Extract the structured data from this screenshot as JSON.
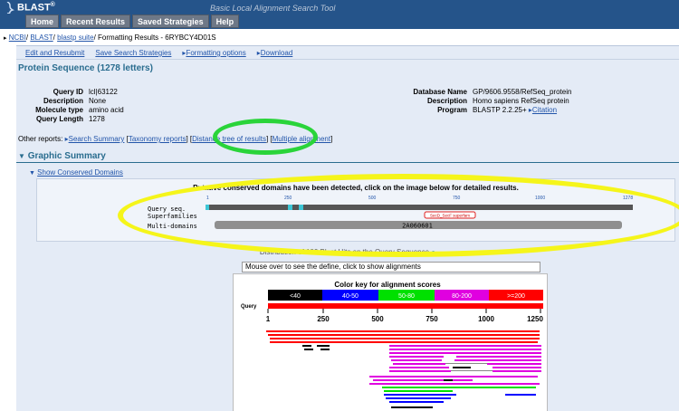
{
  "header": {
    "brand": "BLAST",
    "reg": "®",
    "app_title": "Basic Local Alignment Search Tool",
    "nav": [
      "Home",
      "Recent Results",
      "Saved Strategies",
      "Help"
    ]
  },
  "breadcrumb": {
    "ncbi": "NCBI",
    "blast": "BLAST",
    "suite": "blastp suite",
    "current": "Formatting Results - 6RYBCY4D01S"
  },
  "toolbar": {
    "edit": "Edit and Resubmit",
    "save": "Save Search Strategies",
    "formatting": "Formatting options",
    "download": "Download"
  },
  "title": "Protein Sequence (1278 letters)",
  "query_info": {
    "labels": [
      "Query ID",
      "Description",
      "Molecule type",
      "Query Length"
    ],
    "values": [
      "lcl|63122",
      "None",
      "amino acid",
      "1278"
    ]
  },
  "db_info": {
    "labels": [
      "Database Name",
      "Description",
      "Program"
    ],
    "values": [
      "GP/9606.9558/RefSeq_protein",
      "Homo sapiens RefSeq protein",
      "BLASTP 2.2.25+"
    ],
    "citation": "Citation"
  },
  "other_reports": {
    "label": "Other reports:",
    "search_summary": "Search Summary",
    "taxonomy": "Taxonomy reports",
    "distance_tree": "Distance tree of results",
    "multiple": "Multiple alignment"
  },
  "graphic_summary": {
    "title": "Graphic Summary",
    "show_cd": "Show Conserved Domains",
    "cd_note": "Putative conserved domains have been detected, click on the image below for detailed results.",
    "rows": [
      "Query seq.",
      "Superfamilies",
      "Multi-domains"
    ],
    "ticks": [
      "1",
      "250",
      "500",
      "750",
      "1000",
      "1278"
    ],
    "superfamily_label": "SecD_SecF superfam",
    "multidomain_label": "2A060601"
  },
  "distribution": {
    "title": "Distribution of 100 Blast Hits on the Query Sequence",
    "mouseover": "Mouse over to see the define, click to show alignments",
    "color_key_title": "Color key for alignment scores",
    "color_key": [
      {
        "label": "<40",
        "color": "#000000"
      },
      {
        "label": "40-50",
        "color": "#0000ff"
      },
      {
        "label": "50-80",
        "color": "#00e000"
      },
      {
        "label": "80-200",
        "color": "#e000e0"
      },
      {
        "label": ">=200",
        "color": "#ff0000"
      }
    ],
    "query_label": "Query",
    "axis_ticks": [
      "1",
      "250",
      "500",
      "750",
      "1000",
      "1250"
    ]
  },
  "colors": {
    "header_bg": "#25548a",
    "link": "#2255aa",
    "section_title": "#2a6d8f",
    "annotation_green": "#2ad43a",
    "annotation_yellow": "#f5f51a"
  }
}
